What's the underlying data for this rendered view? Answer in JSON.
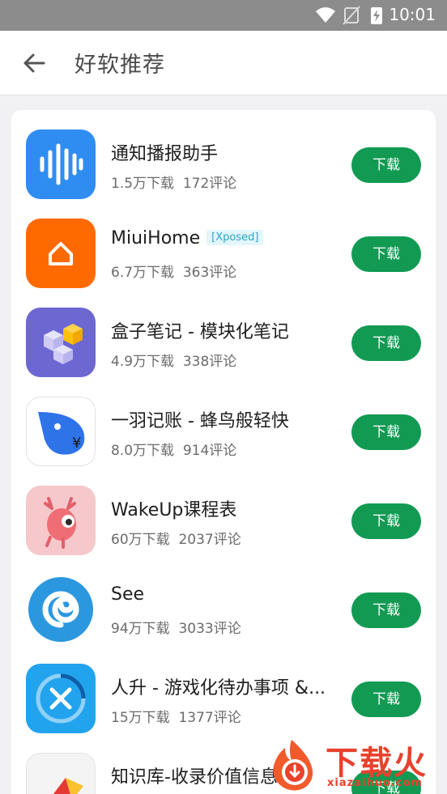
{
  "status_bar": {
    "time": "10:01"
  },
  "app_bar": {
    "title": "好软推荐"
  },
  "apps": [
    {
      "name": "通知播报助手",
      "downloads": "1.5万下载",
      "comments": "172评论",
      "tag": "",
      "action": "下载"
    },
    {
      "name": "MiuiHome",
      "downloads": "6.7万下载",
      "comments": "363评论",
      "tag": "[Xposed]",
      "action": "下载"
    },
    {
      "name": "盒子笔记 - 模块化笔记",
      "downloads": "4.9万下载",
      "comments": "338评论",
      "tag": "",
      "action": "下载"
    },
    {
      "name": "一羽记账 - 蜂鸟般轻快",
      "downloads": "8.0万下载",
      "comments": "914评论",
      "tag": "",
      "action": "下载"
    },
    {
      "name": "WakeUp课程表",
      "downloads": "60万下载",
      "comments": "2037评论",
      "tag": "",
      "action": "下载"
    },
    {
      "name": "See",
      "downloads": "94万下载",
      "comments": "3033评论",
      "tag": "",
      "action": "下载"
    },
    {
      "name": "人升 - 游戏化待办事项 &...",
      "downloads": "15万下载",
      "comments": "1377评论",
      "tag": "",
      "action": "下载"
    },
    {
      "name": "知识库-收录价值信息",
      "downloads": "",
      "comments": "",
      "tag": "",
      "action": "下载"
    }
  ],
  "watermark": {
    "brand": "下载火",
    "url": "xiazaihuo.com"
  },
  "colors": {
    "accent": "#129a53",
    "tag_text": "#29a8c8",
    "watermark": "#e8412d"
  }
}
